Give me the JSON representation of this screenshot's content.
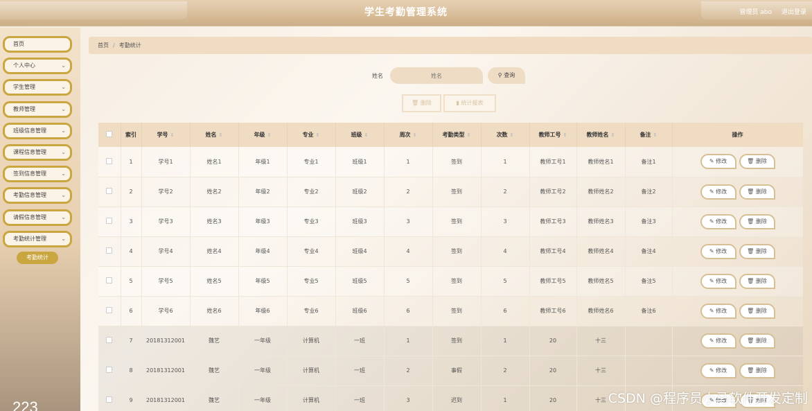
{
  "header": {
    "title": "学生考勤管理系统",
    "user": "管理员 abo",
    "logout": "退出登录"
  },
  "sidebar": {
    "items": [
      {
        "label": "首页",
        "chevron": false
      },
      {
        "label": "个人中心",
        "chevron": true
      },
      {
        "label": "学生管理",
        "chevron": true
      },
      {
        "label": "教师管理",
        "chevron": true
      },
      {
        "label": "班级信息管理",
        "chevron": true
      },
      {
        "label": "课程信息管理",
        "chevron": true
      },
      {
        "label": "签到信息管理",
        "chevron": true
      },
      {
        "label": "考勤信息管理",
        "chevron": true
      },
      {
        "label": "请假信息管理",
        "chevron": true
      },
      {
        "label": "考勤统计管理",
        "chevron": true
      }
    ],
    "submenu": "考勤统计",
    "bottom_number": "223"
  },
  "breadcrumb": {
    "home": "首页",
    "sep": "/",
    "current": "考勤统计"
  },
  "search": {
    "label": "姓名",
    "placeholder": "姓名",
    "button": "查询"
  },
  "actions": {
    "delete": "删除",
    "report": "统计报表"
  },
  "table": {
    "headers": [
      "索引",
      "学号",
      "姓名",
      "年级",
      "专业",
      "班级",
      "周次",
      "考勤类型",
      "次数",
      "教师工号",
      "教师姓名",
      "备注",
      "操作"
    ],
    "sortable": [
      false,
      true,
      true,
      true,
      true,
      true,
      true,
      true,
      true,
      true,
      true,
      true,
      false
    ],
    "rows": [
      [
        "1",
        "学号1",
        "姓名1",
        "年级1",
        "专业1",
        "班级1",
        "1",
        "签到",
        "1",
        "教师工号1",
        "教师姓名1",
        "备注1"
      ],
      [
        "2",
        "学号2",
        "姓名2",
        "年级2",
        "专业2",
        "班级2",
        "2",
        "签到",
        "2",
        "教师工号2",
        "教师姓名2",
        "备注2"
      ],
      [
        "3",
        "学号3",
        "姓名3",
        "年级3",
        "专业3",
        "班级3",
        "3",
        "签到",
        "3",
        "教师工号3",
        "教师姓名3",
        "备注3"
      ],
      [
        "4",
        "学号4",
        "姓名4",
        "年级4",
        "专业4",
        "班级4",
        "4",
        "签到",
        "4",
        "教师工号4",
        "教师姓名4",
        "备注4"
      ],
      [
        "5",
        "学号5",
        "姓名5",
        "年级5",
        "专业5",
        "班级5",
        "5",
        "签到",
        "5",
        "教师工号5",
        "教师姓名5",
        "备注5"
      ],
      [
        "6",
        "学号6",
        "姓名6",
        "年级6",
        "专业6",
        "班级6",
        "6",
        "签到",
        "6",
        "教师工号6",
        "教师姓名6",
        "备注6"
      ],
      [
        "7",
        "20181312001",
        "魏艺",
        "一年级",
        "计算机",
        "一班",
        "1",
        "签到",
        "1",
        "20",
        "十三",
        ""
      ],
      [
        "8",
        "20181312001",
        "魏艺",
        "一年级",
        "计算机",
        "一班",
        "2",
        "事假",
        "2",
        "20",
        "十三",
        ""
      ],
      [
        "9",
        "20181312001",
        "魏艺",
        "一年级",
        "计算机",
        "一班",
        "3",
        "迟到",
        "1",
        "20",
        "十三",
        ""
      ]
    ],
    "edit_label": "修改",
    "delete_label": "删除"
  },
  "watermark": "CSDN @程序员小马软件开发定制",
  "colors": {
    "accent": "#c9a640",
    "header": "#d8bd98",
    "thead": "#efdcc3"
  }
}
